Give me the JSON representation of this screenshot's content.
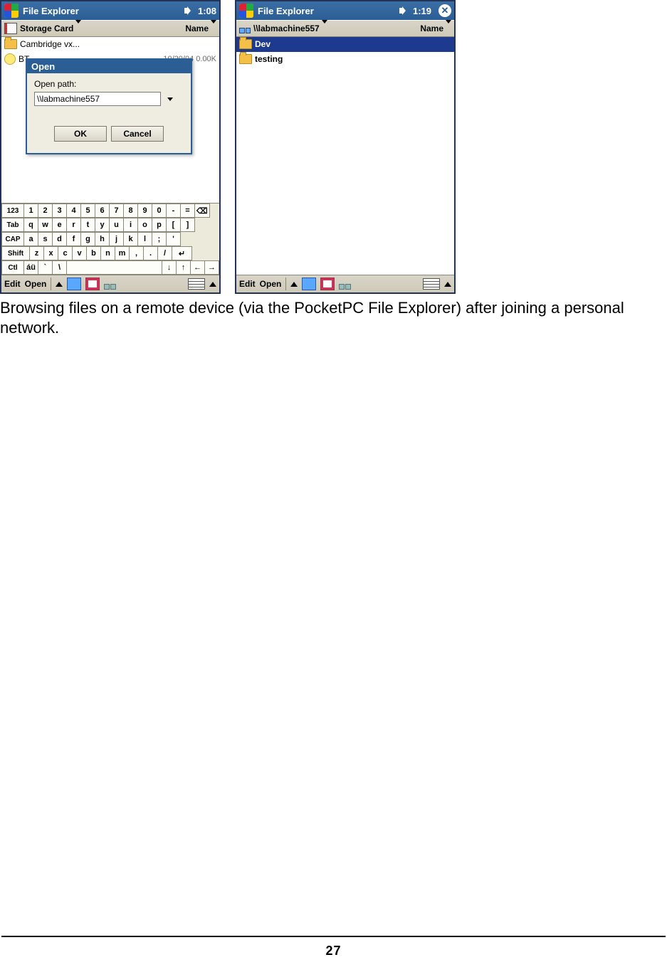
{
  "left": {
    "title": "File Explorer",
    "clock": "1:08",
    "location": "Storage Card",
    "sort": "Name",
    "rows": [
      {
        "icon": "folder",
        "name": "Cambridge vx..."
      },
      {
        "icon": "bulb",
        "name": "BT",
        "meta": "10/20/04   0.00K"
      }
    ],
    "dialog": {
      "title": "Open",
      "label": "Open path:",
      "value": "\\\\labmachine557",
      "ok": "OK",
      "cancel": "Cancel"
    },
    "kbd": {
      "r1_mod": "123",
      "r1": [
        "1",
        "2",
        "3",
        "4",
        "5",
        "6",
        "7",
        "8",
        "9",
        "0",
        "-",
        "="
      ],
      "r2_mod": "Tab",
      "r2": [
        "q",
        "w",
        "e",
        "r",
        "t",
        "y",
        "u",
        "i",
        "o",
        "p",
        "[",
        "]"
      ],
      "r3_mod": "CAP",
      "r3": [
        "a",
        "s",
        "d",
        "f",
        "g",
        "h",
        "j",
        "k",
        "l",
        ";",
        "'"
      ],
      "r4_mod": "Shift",
      "r4": [
        "z",
        "x",
        "c",
        "v",
        "b",
        "n",
        "m",
        ",",
        ".",
        "/"
      ],
      "r5_mod": "Ctl",
      "r5_extra": [
        "áü",
        "`",
        "\\"
      ]
    },
    "menu": {
      "edit": "Edit",
      "open": "Open"
    }
  },
  "right": {
    "title": "File Explorer",
    "clock": "1:19",
    "location": "\\\\labmachine557",
    "sort": "Name",
    "rows": [
      {
        "icon": "folder",
        "name": "Dev",
        "sel": true
      },
      {
        "icon": "folder",
        "name": "testing",
        "sel": false
      }
    ],
    "menu": {
      "edit": "Edit",
      "open": "Open"
    }
  },
  "caption": "Browsing files on a remote device (via the PocketPC File Explorer) after joining a personal network.",
  "page_number": "27"
}
